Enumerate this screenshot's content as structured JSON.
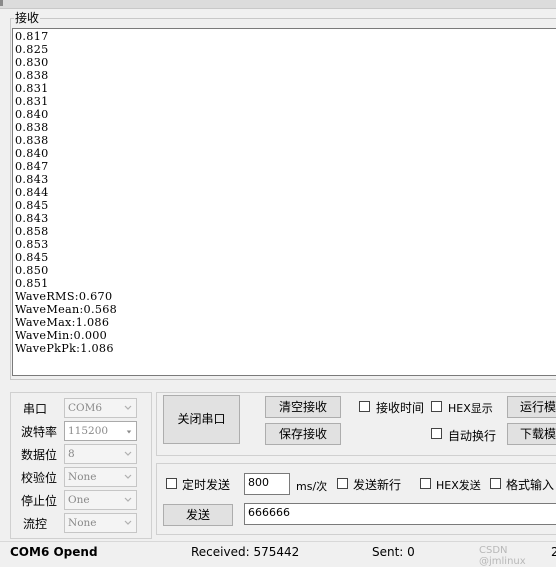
{
  "receive": {
    "label": "接收",
    "text": "0.817\n0.825\n0.830\n0.838\n0.831\n0.831\n0.840\n0.838\n0.838\n0.840\n0.847\n0.843\n0.844\n0.845\n0.843\n0.858\n0.853\n0.845\n0.850\n0.851\nWaveRMS:0.670\nWaveMean:0.568\nWaveMax:1.086\nWaveMin:0.000\nWavePkPk:1.086"
  },
  "port": {
    "labels": {
      "port": "串口",
      "baud": "波特率",
      "data": "数据位",
      "parity": "校验位",
      "stop": "停止位",
      "flow": "流控"
    },
    "values": {
      "port": "COM6",
      "baud": "115200",
      "data": "8",
      "parity": "None",
      "stop": "One",
      "flow": "None"
    }
  },
  "buttons": {
    "close_port": "关闭串口",
    "clear_receive": "清空接收",
    "save_receive": "保存接收",
    "run_mode": "运行模",
    "download_mode": "下载模",
    "send": "发送"
  },
  "options": {
    "receive_time": "接收时间",
    "hex_display": "HEX显示",
    "auto_newline": "自动换行",
    "timed_send": "定时发送",
    "interval_unit": "ms/次",
    "send_newline": "发送新行",
    "hex_send": "HEX发送",
    "format_input": "格式输入"
  },
  "send": {
    "interval_value": "800",
    "input_value": "666666"
  },
  "status": {
    "port_state": "COM6 Opend",
    "received": "Received: 575442",
    "sent": "Sent: 0",
    "watermark": "CSDN @jmlinux",
    "clipped_char": "2"
  },
  "colors": {
    "background": "#f0f0f0",
    "button": "#e1e1e1",
    "field": "#ffffff",
    "disabled_text": "#8a8a8a"
  }
}
